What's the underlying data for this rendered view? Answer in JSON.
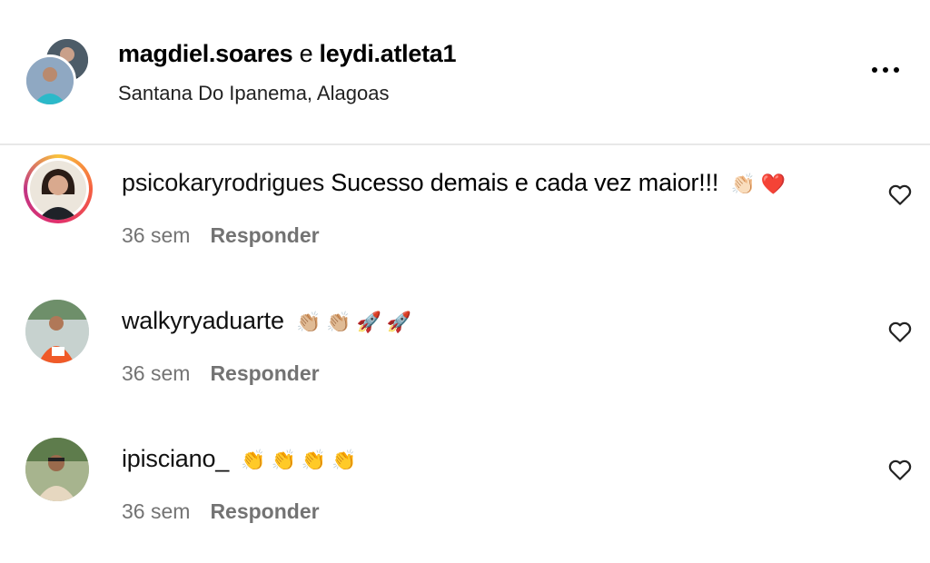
{
  "post_header": {
    "user1": "magdiel.soares",
    "connector": " e ",
    "user2": "leydi.atleta1",
    "location": "Santana Do Ipanema, Alagoas"
  },
  "comments": [
    {
      "username": "psicokaryrodrigues",
      "text": " Sucesso demais e cada vez maior!!!",
      "emojis": [
        "👏🏻",
        "❤️"
      ],
      "time": "36 sem",
      "reply_label": "Responder"
    },
    {
      "username": "walkyryaduarte",
      "text": "",
      "emojis": [
        "👏🏼",
        "👏🏼",
        "🚀",
        "🚀"
      ],
      "time": "36 sem",
      "reply_label": "Responder"
    },
    {
      "username": "ipisciano_",
      "text": "",
      "emojis": [
        "👏",
        "👏",
        "👏",
        "👏"
      ],
      "time": "36 sem",
      "reply_label": "Responder"
    }
  ],
  "icons": {
    "more": "more-options-icon",
    "like": "heart-outline-icon"
  }
}
